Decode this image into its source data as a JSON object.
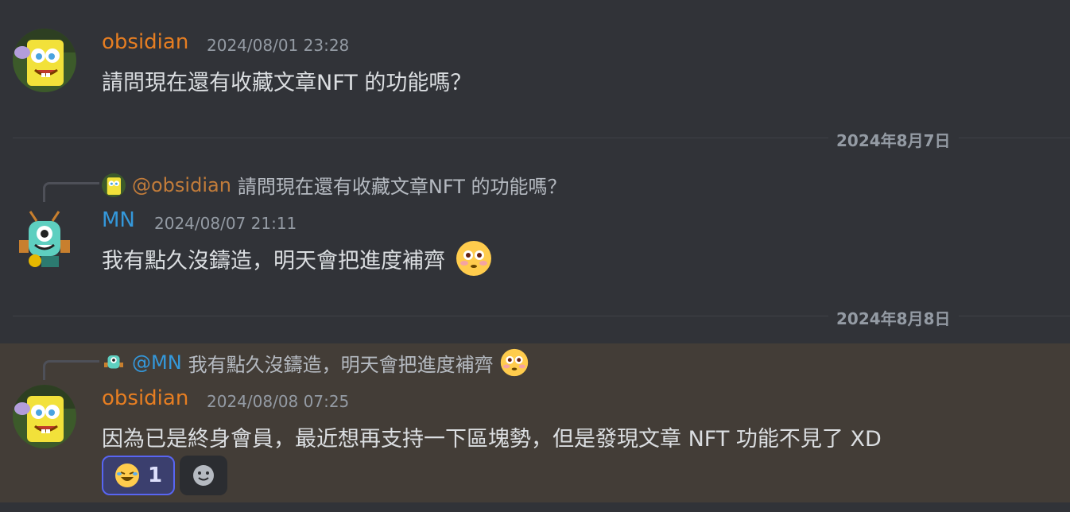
{
  "messages": [
    {
      "author": "obsidian",
      "author_color": "#e67e22",
      "timestamp": "2024/08/01 23:28",
      "text": "請問現在還有收藏文章NFT 的功能嗎？"
    },
    {
      "author": "MN",
      "author_color": "#3498db",
      "timestamp": "2024/08/07 21:11",
      "text": "我有點久沒鑄造，明天會把進度補齊",
      "emoji": "flushed-face",
      "reply": {
        "mention": "@obsidian",
        "text": "請問現在還有收藏文章NFT 的功能嗎？"
      }
    },
    {
      "author": "obsidian",
      "author_color": "#e67e22",
      "timestamp": "2024/08/08 07:25",
      "text": "因為已是終身會員，最近想再支持一下區塊勢，但是發現文章 NFT 功能不見了 XD",
      "reply": {
        "mention": "@MN",
        "text": "我有點久沒鑄造，明天會把進度補齊",
        "emoji": "flushed-face"
      },
      "reactions": [
        {
          "emoji": "rofl-face",
          "count": "1"
        }
      ]
    }
  ],
  "dividers": [
    {
      "label": "2024年8月7日"
    },
    {
      "label": "2024年8月8日"
    }
  ],
  "colors": {
    "background": "#313338",
    "highlight": "#433d37",
    "mention": "#c9cdfb"
  }
}
